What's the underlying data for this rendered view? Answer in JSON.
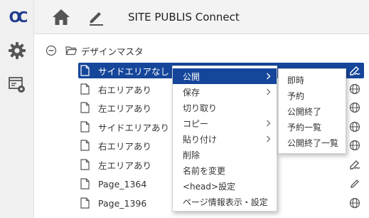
{
  "header": {
    "logo_text": "OC",
    "title": "SITE PUBLIS Connect",
    "icons": {
      "home": "home-icon",
      "edit": "pencil-icon"
    }
  },
  "rail": {
    "icons": [
      "gear-icon",
      "site-settings-icon"
    ]
  },
  "colors": {
    "accent": "#15469a",
    "brand": "#1f3a8c",
    "icon": "#555555"
  },
  "tree": {
    "root": {
      "label": "デザインマスタ",
      "expanded": true
    },
    "items": [
      {
        "label": "サイドエリアなし",
        "status": "edit-pending",
        "selected": true
      },
      {
        "label": "右エリアあり",
        "status": "published"
      },
      {
        "label": "左エリアあり",
        "status": "published"
      },
      {
        "label": "サイドエリアあり",
        "status": "published"
      },
      {
        "label": "右エリアあり",
        "status": "published"
      },
      {
        "label": "左エリアあり",
        "status": "edit-pending"
      },
      {
        "label": "Page_1364",
        "status": "editing"
      },
      {
        "label": "Page_1396",
        "status": "published"
      }
    ]
  },
  "context_menu": {
    "items": [
      {
        "label": "公開",
        "has_submenu": true,
        "active": true
      },
      {
        "label": "保存",
        "has_submenu": true
      },
      {
        "label": "切り取り"
      },
      {
        "label": "コピー",
        "has_submenu": true
      },
      {
        "label": "貼り付け",
        "has_submenu": true
      },
      {
        "label": "削除"
      },
      {
        "label": "名前を変更"
      },
      {
        "label": "<head>設定"
      },
      {
        "label": "ページ情報表示・設定"
      }
    ]
  },
  "submenu": {
    "items": [
      {
        "label": "即時"
      },
      {
        "label": "予約"
      },
      {
        "label": "公開終了"
      },
      {
        "label": "予約一覧"
      },
      {
        "label": "公開終了一覧"
      }
    ]
  }
}
